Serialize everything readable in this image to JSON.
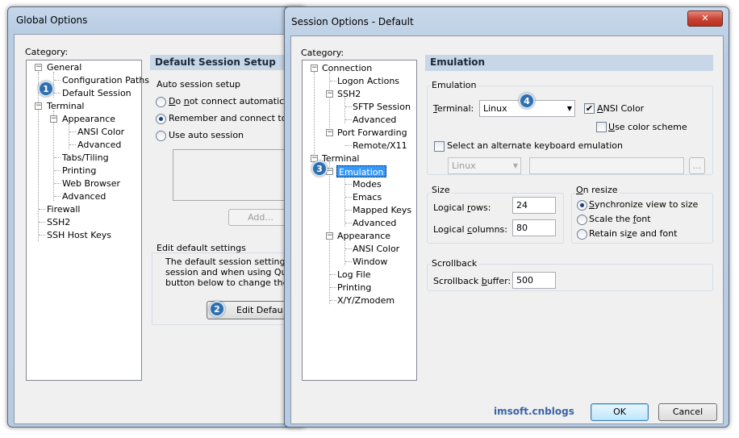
{
  "global": {
    "title": "Global Options",
    "category_label": "Category:",
    "tree": [
      {
        "label": "General"
      },
      {
        "label": "Configuration Paths"
      },
      {
        "label": "Default Session"
      },
      {
        "label": "Terminal"
      },
      {
        "label": "Appearance"
      },
      {
        "label": "ANSI Color"
      },
      {
        "label": "Advanced"
      },
      {
        "label": "Tabs/Tiling"
      },
      {
        "label": "Printing"
      },
      {
        "label": "Web Browser"
      },
      {
        "label": "Advanced"
      },
      {
        "label": "Firewall"
      },
      {
        "label": "SSH2"
      },
      {
        "label": "SSH Host Keys"
      }
    ],
    "header": "Default Session Setup",
    "auto_setup_label": "Auto session setup",
    "radio1": "Do not connect automatically o",
    "radio2": "Remember and connect to ses",
    "radio3": "Use auto session",
    "add_button": "Add...",
    "edit_group_label": "Edit default settings",
    "edit_text1": "The default session settings are",
    "edit_text2": "session and when using Quick C",
    "edit_text3": "button below to change the de",
    "edit_button": "Edit Defau"
  },
  "session": {
    "title": "Session Options - Default",
    "close": "✕",
    "category_label": "Category:",
    "tree": [
      {
        "label": "Connection"
      },
      {
        "label": "Logon Actions"
      },
      {
        "label": "SSH2"
      },
      {
        "label": "SFTP Session"
      },
      {
        "label": "Advanced"
      },
      {
        "label": "Port Forwarding"
      },
      {
        "label": "Remote/X11"
      },
      {
        "label": "Terminal"
      },
      {
        "label": "Emulation"
      },
      {
        "label": "Modes"
      },
      {
        "label": "Emacs"
      },
      {
        "label": "Mapped Keys"
      },
      {
        "label": "Advanced"
      },
      {
        "label": "Appearance"
      },
      {
        "label": "ANSI Color"
      },
      {
        "label": "Window"
      },
      {
        "label": "Log File"
      },
      {
        "label": "Printing"
      },
      {
        "label": "X/Y/Zmodem"
      }
    ],
    "header": "Emulation",
    "emulation_group": "Emulation",
    "terminal_label": "Terminal:",
    "terminal_value": "Linux",
    "ansi_color": "ANSI Color",
    "use_color_scheme": "Use color scheme",
    "alt_keyboard": "Select an alternate keyboard emulation",
    "alt_keyboard_value": "Linux",
    "browse": "...",
    "size_group": "Size",
    "logical_rows_label": "Logical rows:",
    "logical_rows_value": "24",
    "logical_cols_label": "Logical columns:",
    "logical_cols_value": "80",
    "resize_group": "On resize",
    "resize1": "Synchronize view to size",
    "resize2": "Scale the font",
    "resize3": "Retain size and font",
    "scrollback_group": "Scrollback",
    "scrollback_label": "Scrollback buffer:",
    "scrollback_value": "500",
    "watermark": "imsoft.cnblogs",
    "ok": "OK",
    "cancel": "Cancel"
  },
  "badges": [
    "1",
    "2",
    "3",
    "4"
  ],
  "colors": {
    "accent": "#2f6fae",
    "header_bg": "#c8d7e7",
    "selection": "#3399ff",
    "close_button": "#c84031"
  }
}
